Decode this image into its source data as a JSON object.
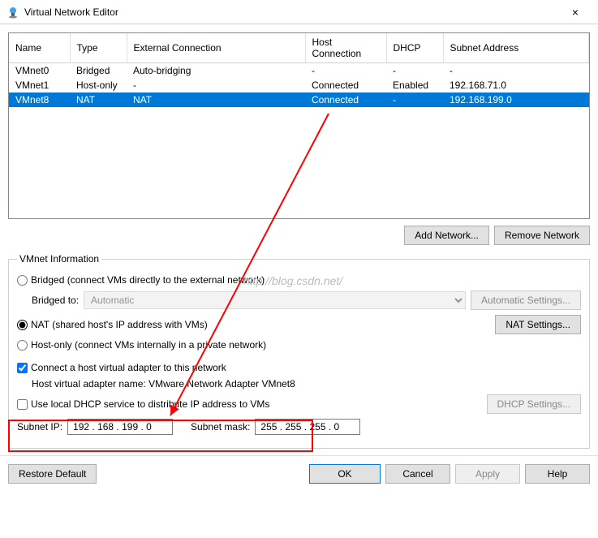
{
  "window": {
    "title": "Virtual Network Editor",
    "close": "×"
  },
  "table": {
    "headers": {
      "name": "Name",
      "type": "Type",
      "ext": "External Connection",
      "host": "Host Connection",
      "dhcp": "DHCP",
      "subnet": "Subnet Address"
    },
    "rows": [
      {
        "name": "VMnet0",
        "type": "Bridged",
        "ext": "Auto-bridging",
        "host": "-",
        "dhcp": "-",
        "subnet": "-"
      },
      {
        "name": "VMnet1",
        "type": "Host-only",
        "ext": "-",
        "host": "Connected",
        "dhcp": "Enabled",
        "subnet": "192.168.71.0"
      },
      {
        "name": "VMnet8",
        "type": "NAT",
        "ext": "NAT",
        "host": "Connected",
        "dhcp": "-",
        "subnet": "192.168.199.0"
      }
    ]
  },
  "buttons": {
    "add": "Add Network...",
    "remove": "Remove Network",
    "auto": "Automatic Settings...",
    "nat": "NAT Settings...",
    "dhcp": "DHCP Settings...",
    "restore": "Restore Default",
    "ok": "OK",
    "cancel": "Cancel",
    "apply": "Apply",
    "help": "Help"
  },
  "fieldset": {
    "legend": "VMnet Information",
    "bridged": "Bridged (connect VMs directly to the external network)",
    "bridgedTo": "Bridged to:",
    "bridgedSel": "Automatic",
    "nat": "NAT (shared host's IP address with VMs)",
    "hostonly": "Host-only (connect VMs internally in a private network)",
    "hostAdapter": "Connect a host virtual adapter to this network",
    "hostAdapterName": "Host virtual adapter name: VMware Network Adapter VMnet8",
    "dhcpLocal": "Use local DHCP service to distribute IP address to VMs",
    "subnetIpLabel": "Subnet IP:",
    "subnetIp": "192 . 168 . 199 .  0",
    "subnetMaskLabel": "Subnet mask:",
    "subnetMask": "255 . 255 . 255 .  0"
  },
  "watermark": "http://blog.csdn.net/"
}
